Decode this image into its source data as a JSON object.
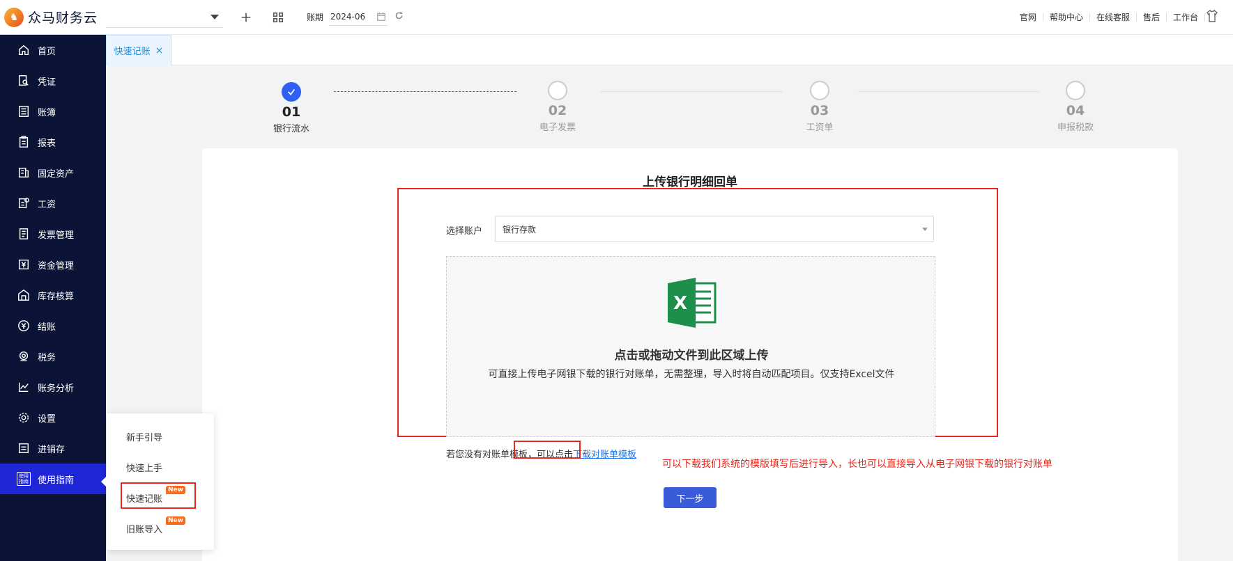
{
  "app": {
    "name": "众马财务云"
  },
  "sidebar": {
    "items": [
      {
        "label": "首页",
        "icon": "home-icon"
      },
      {
        "label": "凭证",
        "icon": "voucher-icon"
      },
      {
        "label": "账簿",
        "icon": "ledger-icon"
      },
      {
        "label": "报表",
        "icon": "report-icon"
      },
      {
        "label": "固定资产",
        "icon": "fixed-asset-icon"
      },
      {
        "label": "工资",
        "icon": "salary-icon"
      },
      {
        "label": "发票管理",
        "icon": "invoice-icon"
      },
      {
        "label": "资金管理",
        "icon": "fund-icon"
      },
      {
        "label": "库存核算",
        "icon": "inventory-icon"
      },
      {
        "label": "结账",
        "icon": "closing-icon"
      },
      {
        "label": "税务",
        "icon": "tax-icon"
      },
      {
        "label": "账务分析",
        "icon": "analysis-icon"
      },
      {
        "label": "设置",
        "icon": "gear-icon"
      },
      {
        "label": "进销存",
        "icon": "purchase-sales-icon"
      },
      {
        "label": "使用指南",
        "icon": "guide-icon",
        "icon_text": "使用\n指南"
      }
    ]
  },
  "topbar": {
    "period_label": "账期",
    "period_value": "2024-06",
    "links": [
      "官网",
      "帮助中心",
      "在线客服",
      "售后",
      "工作台"
    ]
  },
  "tabs": [
    {
      "label": "快速记账"
    }
  ],
  "steps": [
    {
      "num": "01",
      "label": "银行流水",
      "done": true
    },
    {
      "num": "02",
      "label": "电子发票",
      "done": false
    },
    {
      "num": "03",
      "label": "工资单",
      "done": false
    },
    {
      "num": "04",
      "label": "申报税款",
      "done": false
    }
  ],
  "upload": {
    "title": "上传银行明细回单",
    "account_label": "选择账户",
    "account_value": "银行存款",
    "dropzone_title": "点击或拖动文件到此区域上传",
    "dropzone_sub": "可直接上传电子网银下载的银行对账单，无需整理，导入时将自动匹配项目。仅支持Excel文件",
    "template_hint": "若您没有对账单模板，可以点击",
    "template_link": "下载对账单模板",
    "annotation": "可以下载我们系统的模版填写后进行导入，长也可以直接导入从电子网银下载的银行对账单",
    "next_button": "下一步"
  },
  "guide_menu": {
    "items": [
      {
        "label": "新手引导",
        "badge": ""
      },
      {
        "label": "快速上手",
        "badge": ""
      },
      {
        "label": "快速记账",
        "badge": "New"
      },
      {
        "label": "旧账导入",
        "badge": "New"
      }
    ]
  },
  "colors": {
    "sidebar_bg": "#0b1437",
    "active_nav": "#1f26d8",
    "primary": "#3a5bd9",
    "highlight_red": "#e8261b",
    "badge": "#f76b1c"
  }
}
